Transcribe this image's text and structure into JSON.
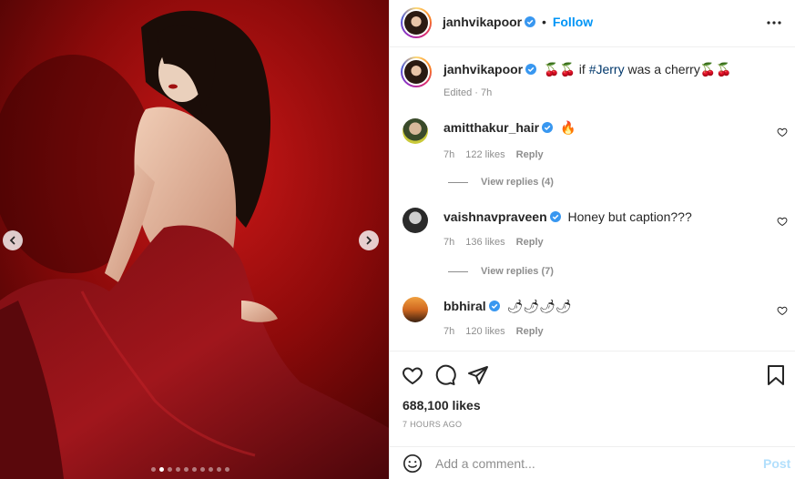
{
  "post": {
    "username": "janhvikapoor",
    "follow_label": "Follow",
    "caption": {
      "username": "janhvikapoor",
      "emoji_before": "🍒🍒",
      "text_before": " if ",
      "hashtag": "#Jerry",
      "text_after": " was a cherry",
      "emoji_after": "🍒🍒",
      "meta": "Edited · 7h"
    },
    "carousel": {
      "total": 10,
      "active_index": 1
    }
  },
  "comments": [
    {
      "username": "amitthakur_hair",
      "text": "🔥",
      "time": "7h",
      "likes": "122 likes",
      "reply_label": "Reply",
      "view_replies": "View replies (4)",
      "verified": true
    },
    {
      "username": "vaishnavpraveen",
      "text": "Honey but caption???",
      "time": "7h",
      "likes": "136 likes",
      "reply_label": "Reply",
      "view_replies": "View replies (7)",
      "verified": true
    },
    {
      "username": "bbhiral",
      "text": "🌶🌶🌶🌶",
      "time": "7h",
      "likes": "120 likes",
      "reply_label": "Reply",
      "verified": true
    }
  ],
  "actions": {
    "likes": "688,100 likes",
    "time_ago": "7 HOURS AGO"
  },
  "add_comment": {
    "placeholder": "Add a comment...",
    "post_label": "Post"
  },
  "colors": {
    "accent": "#0095f6",
    "verified": "#3897f0",
    "muted": "#8e8e8e"
  },
  "icons": [
    "chevron-left-icon",
    "chevron-right-icon",
    "more-icon",
    "verified-icon",
    "heart-icon",
    "comment-icon",
    "share-icon",
    "bookmark-icon",
    "emoji-icon"
  ]
}
